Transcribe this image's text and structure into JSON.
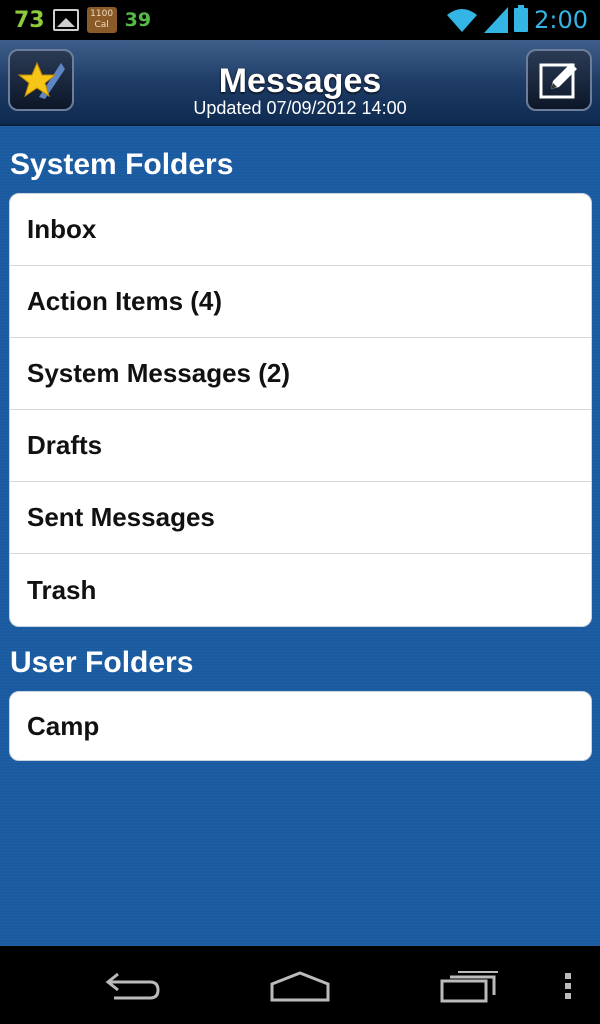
{
  "status_bar": {
    "left_number": "73",
    "gallery_icon": "gallery-icon",
    "calorie_badge_line1": "1100",
    "calorie_badge_line2": "Cal",
    "right_number": "39",
    "time": "2:00",
    "icons": [
      "wifi-icon",
      "signal-icon",
      "battery-icon"
    ],
    "accent_color": "#33b5e5"
  },
  "header": {
    "title": "Messages",
    "subtitle": "Updated 07/09/2012 14:00",
    "left_button_icon": "star-app-icon",
    "right_button_icon": "compose-icon"
  },
  "sections": {
    "system": {
      "title": "System Folders",
      "items": [
        {
          "label": "Inbox"
        },
        {
          "label": "Action Items (4)"
        },
        {
          "label": "System Messages (2)"
        },
        {
          "label": "Drafts"
        },
        {
          "label": "Sent Messages"
        },
        {
          "label": "Trash"
        }
      ]
    },
    "user": {
      "title": "User Folders",
      "items": [
        {
          "label": "Camp"
        }
      ]
    }
  },
  "nav_bar": {
    "icons": [
      "back-icon",
      "home-icon",
      "recent-apps-icon",
      "menu-icon"
    ]
  },
  "colors": {
    "background": "#1a5aa0",
    "header": "#1e3c66",
    "list_background": "#ffffff"
  }
}
